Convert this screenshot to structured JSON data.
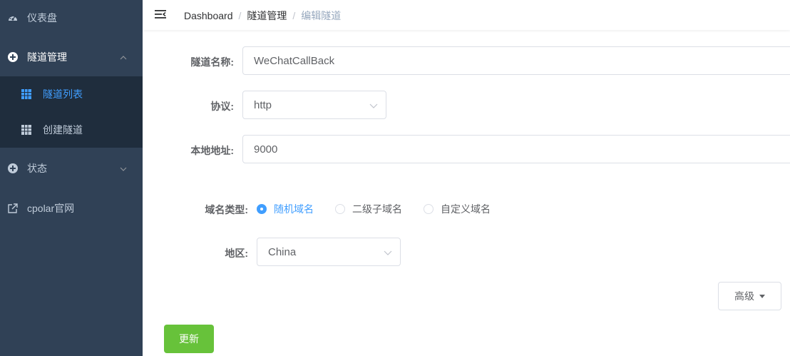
{
  "sidebar": {
    "items": [
      {
        "label": "仪表盘",
        "icon": "dashboard-icon"
      },
      {
        "label": "隧道管理",
        "icon": "circle-plus-icon"
      },
      {
        "label": "状态",
        "icon": "circle-plus-icon"
      },
      {
        "label": "cpolar官网",
        "icon": "external-link-icon"
      }
    ],
    "submenu": [
      {
        "label": "隧道列表",
        "icon": "grid-icon",
        "active": true
      },
      {
        "label": "创建隧道",
        "icon": "grid-icon",
        "active": false
      }
    ],
    "colors": {
      "bg": "#304156",
      "submenu_bg": "#1f2d3d",
      "text": "#bfcbd9",
      "active": "#409eff"
    }
  },
  "header": {
    "breadcrumb": [
      "Dashboard",
      "隧道管理",
      "编辑隧道"
    ],
    "separator": "/"
  },
  "form": {
    "tunnel_name": {
      "label": "隧道名称:",
      "value": "WeChatCallBack"
    },
    "protocol": {
      "label": "协议:",
      "value": "http"
    },
    "local_address": {
      "label": "本地地址:",
      "value": "9000"
    },
    "domain_type": {
      "label": "域名类型:",
      "options": [
        "随机域名",
        "二级子域名",
        "自定义域名"
      ],
      "selected": "随机域名"
    },
    "region": {
      "label": "地区:",
      "value": "China"
    },
    "advanced_label": "高级",
    "update_label": "更新"
  },
  "colors": {
    "primary": "#409eff",
    "success": "#67c23a"
  }
}
